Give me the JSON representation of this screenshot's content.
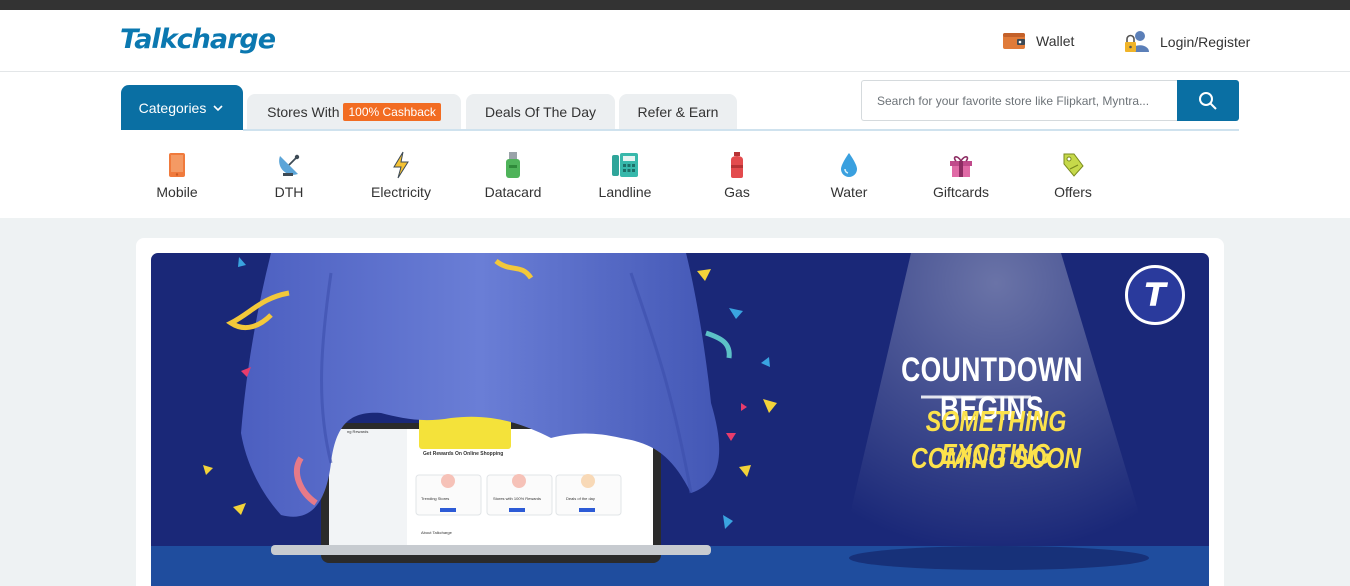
{
  "header": {
    "logo": "Talkcharge",
    "wallet_label": "Wallet",
    "login_label": "Login/Register"
  },
  "nav": {
    "tabs": [
      {
        "label": "Categories"
      },
      {
        "label": "Stores With",
        "badge": "100% Cashback"
      },
      {
        "label": "Deals Of The Day"
      },
      {
        "label": "Refer & Earn"
      }
    ]
  },
  "search": {
    "placeholder": "Search for your favorite store like Flipkart, Myntra..."
  },
  "categories": [
    {
      "label": "Mobile",
      "icon": "mobile-icon"
    },
    {
      "label": "DTH",
      "icon": "dish-antenna-icon"
    },
    {
      "label": "Electricity",
      "icon": "lightning-icon"
    },
    {
      "label": "Datacard",
      "icon": "usb-datacard-icon"
    },
    {
      "label": "Landline",
      "icon": "landline-phone-icon"
    },
    {
      "label": "Gas",
      "icon": "gas-cylinder-icon"
    },
    {
      "label": "Water",
      "icon": "water-drop-icon"
    },
    {
      "label": "Giftcards",
      "icon": "gift-icon"
    },
    {
      "label": "Offers",
      "icon": "tag-icon"
    }
  ],
  "banner": {
    "headline": "COUNTDOWN BEGINS",
    "line1": "SOMETHING EXCITING",
    "line2": "COMING SOON",
    "logo_letter": "T",
    "screen_title": "Get Rewards On Online Shopping",
    "screen_cards": [
      "Trending Stores",
      "Stores with 100% Rewards",
      "Deals of the day"
    ],
    "screen_footer": "About Talkcharge",
    "screen_side": "ng Rewards"
  },
  "colors": {
    "brand": "#0a6fa3",
    "badge": "#f26c22",
    "banner_bg": "#1a2878",
    "banner_yellow": "#fce24b"
  }
}
